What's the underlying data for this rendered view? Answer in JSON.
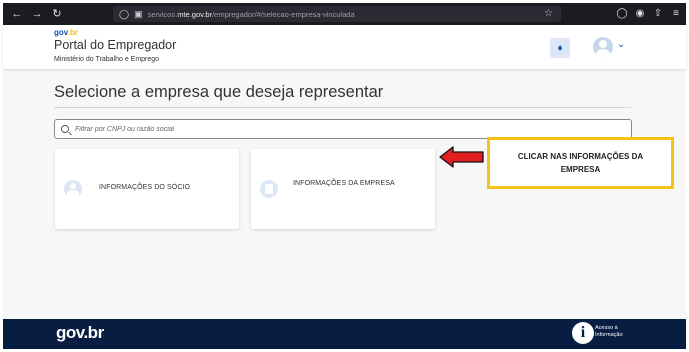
{
  "browser": {
    "url_prefix": "servicos.",
    "url_domain": "mte.gov.br",
    "url_path": "/empregador/#/selecao-empresa-vinculada"
  },
  "header": {
    "logo_gov": "gov",
    "logo_br": ".br",
    "portal_title": "Portal do Empregador",
    "ministry": "Ministério do Trabalho e Emprego"
  },
  "main": {
    "heading": "Selecione a empresa que deseja representar",
    "search_placeholder": "Filtrar por CNPJ ou razão social",
    "cards": [
      {
        "label": "INFORMAÇÕES DO SÓCIO"
      },
      {
        "label": "INFORMAÇÕES DA EMPRESA"
      }
    ]
  },
  "annotation": {
    "callout_text": "CLICAR NAS INFORMAÇÕES DA EMPRESA",
    "arrow_color": "#e02020",
    "border_color": "#f6c414"
  },
  "footer": {
    "logo": "gov.br",
    "info_icon_letter": "i",
    "info_label": "Acesso à Informação"
  },
  "colors": {
    "primary": "#1351b4",
    "footer_bg": "#071d41"
  }
}
